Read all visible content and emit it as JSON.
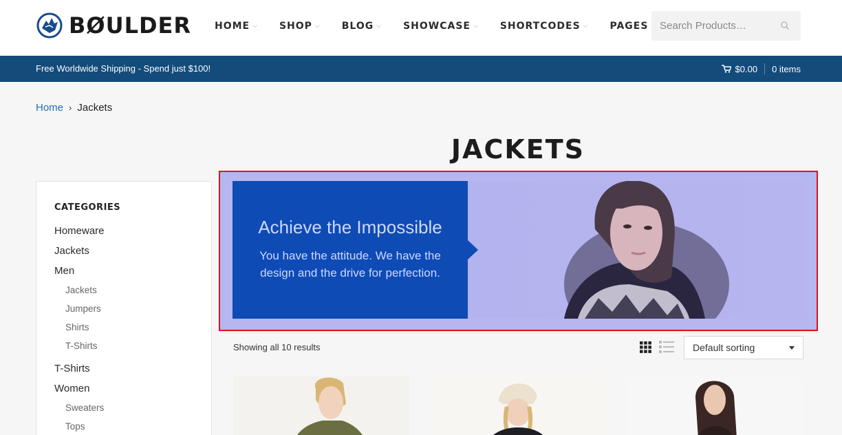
{
  "brand": {
    "name": "BØULDER"
  },
  "nav": {
    "items": [
      {
        "label": "HOME"
      },
      {
        "label": "SHOP"
      },
      {
        "label": "BLOG"
      },
      {
        "label": "SHOWCASE"
      },
      {
        "label": "SHORTCODES"
      },
      {
        "label": "PAGES"
      }
    ]
  },
  "search": {
    "placeholder": "Search Products…"
  },
  "topbar": {
    "message": "Free Worldwide Shipping - Spend just $100!",
    "cart_total": "$0.00",
    "cart_items": "0 items"
  },
  "breadcrumb": {
    "home": "Home",
    "current": "Jackets"
  },
  "page": {
    "title": "JACKETS"
  },
  "sidebar": {
    "heading": "CATEGORIES",
    "items": [
      {
        "label": "Homeware"
      },
      {
        "label": "Jackets"
      },
      {
        "label": "Men"
      },
      {
        "label": "Jackets"
      },
      {
        "label": "Jumpers"
      },
      {
        "label": "Shirts"
      },
      {
        "label": "T-Shirts"
      },
      {
        "label": "T-Shirts"
      },
      {
        "label": "Women"
      },
      {
        "label": "Sweaters"
      },
      {
        "label": "Tops"
      }
    ]
  },
  "banner": {
    "title": "Achieve the Impossible",
    "subtitle": "You have the attitude. We have the design and the drive for perfection."
  },
  "shop": {
    "results_text": "Showing all 10 results",
    "sort_selected": "Default sorting"
  },
  "colors": {
    "accent": "#134b7a",
    "banner_box": "#0e4bb5",
    "highlight_border": "#e0101a",
    "link": "#1d6fb8"
  }
}
